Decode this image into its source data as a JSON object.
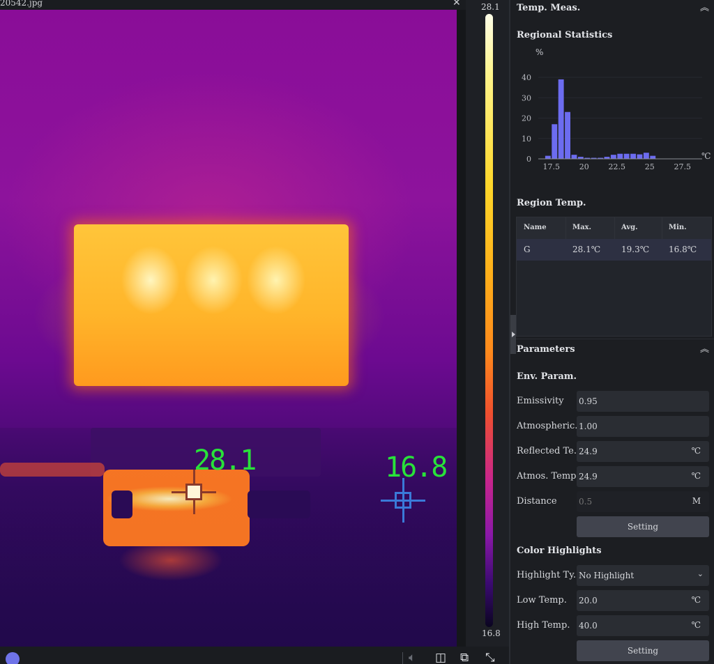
{
  "viewer": {
    "title": "20542.jpg",
    "close_icon": "close-icon",
    "max_marker": {
      "label": "28.1",
      "color": "#29e23a",
      "cross_color": "#8a3a2a"
    },
    "min_marker": {
      "label": "16.8",
      "color": "#29e23a",
      "cross_color": "#3a7ad8"
    },
    "toolbar": {
      "icons": [
        "volume-icon",
        "split-view-icon",
        "copy-icon",
        "fullscreen-icon"
      ]
    }
  },
  "scale": {
    "max": "28.1",
    "min": "16.8",
    "palette": "ironbow"
  },
  "panel": {
    "temp_meas": {
      "title": "Temp. Meas.",
      "collapse_icon": "double-chevron-up-icon"
    },
    "regional_stats": {
      "title": "Regional Statistics"
    },
    "region_temp": {
      "title": "Region Temp.",
      "columns": [
        "Name",
        "Max.",
        "Avg.",
        "Min."
      ],
      "rows": [
        [
          "G",
          "28.1℃",
          "19.3℃",
          "16.8℃"
        ]
      ]
    },
    "parameters": {
      "title": "Parameters",
      "collapse_icon": "double-chevron-up-icon",
      "env_param": {
        "title": "Env. Param.",
        "fields": [
          {
            "label": "Emissivity",
            "value": "0.95",
            "unit": ""
          },
          {
            "label": "Atmospheric...",
            "value": "1.00",
            "unit": ""
          },
          {
            "label": "Reflected Te...",
            "value": "24.9",
            "unit": "℃"
          },
          {
            "label": "Atmos. Temp.",
            "value": "24.9",
            "unit": "℃"
          },
          {
            "label": "Distance",
            "value": "",
            "placeholder": "0.5",
            "unit": "M"
          }
        ],
        "button": "Setting"
      },
      "color_highlights": {
        "title": "Color Highlights",
        "highlight_type": {
          "label": "Highlight Ty...",
          "value": "No Highlight"
        },
        "fields": [
          {
            "label": "Low Temp.",
            "value": "20.0",
            "unit": "℃"
          },
          {
            "label": "High Temp.",
            "value": "40.0",
            "unit": "℃"
          }
        ],
        "button": "Setting"
      }
    }
  },
  "chart_data": {
    "type": "bar",
    "title": "Regional Statistics",
    "xlabel": "℃",
    "ylabel": "%",
    "bar_color": "#6c6cf0",
    "x_ticks": [
      17.5,
      20,
      22.5,
      25,
      27.5
    ],
    "y_ticks": [
      0,
      10,
      20,
      30,
      40
    ],
    "xlim": [
      16.5,
      29.0
    ],
    "ylim": [
      0,
      40
    ],
    "bin_width": 0.5,
    "bins": [
      17.0,
      17.5,
      18.0,
      18.5,
      19.0,
      19.5,
      20.0,
      20.5,
      21.0,
      21.5,
      22.0,
      22.5,
      23.0,
      23.5,
      24.0,
      24.5,
      25.0,
      25.5
    ],
    "values": [
      1.5,
      17,
      39,
      23,
      2,
      1,
      0.5,
      0.5,
      0.5,
      1,
      2,
      2.5,
      2.5,
      2.5,
      2.2,
      3,
      1.5,
      0
    ]
  }
}
